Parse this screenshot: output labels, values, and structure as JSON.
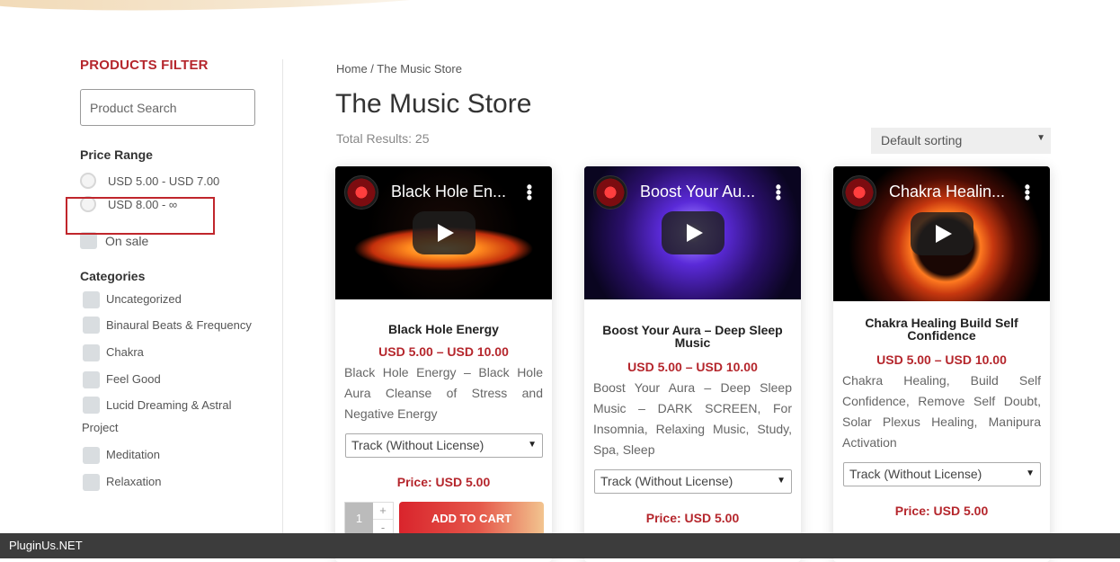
{
  "sidebar": {
    "filter_title": "PRODUCTS FILTER",
    "search_placeholder": "Product Search",
    "price_range_title": "Price Range",
    "price_options": [
      "USD 5.00 - USD 7.00",
      "USD 8.00 - ∞"
    ],
    "on_sale_label": "On sale",
    "categories_title": "Categories",
    "categories": [
      "Uncategorized",
      "Binaural Beats & Frequency",
      "Chakra",
      "Feel Good",
      "Lucid Dreaming & Astral Project",
      "Meditation",
      "Relaxation"
    ]
  },
  "main": {
    "breadcrumb": "Home / The Music Store",
    "title": "The Music Store",
    "total_results": "Total Results: 25",
    "sort_selected": "Default sorting"
  },
  "products": [
    {
      "video_title": "Black Hole En...",
      "name": "Black Hole Energy",
      "price_range": "USD 5.00 – USD 10.00",
      "description": "Black Hole Energy – Black Hole Aura Cleanse of Stress and Negative Energy",
      "variation": "Track (Without License)",
      "price": "Price: USD 5.00",
      "qty": "1",
      "qty_plus": "+",
      "qty_minus": "-",
      "cart_label": "ADD TO CART"
    },
    {
      "video_title": "Boost Your Au...",
      "name": "Boost Your Aura – Deep Sleep Music",
      "price_range": "USD 5.00 – USD 10.00",
      "description": "Boost Your Aura – Deep Sleep Music – DARK SCREEN, For Insomnia, Relaxing Music, Study, Spa, Sleep",
      "variation": "Track (Without License)",
      "price": "Price: USD 5.00"
    },
    {
      "video_title": "Chakra Healin...",
      "name": "Chakra Healing Build Self Confidence",
      "price_range": "USD 5.00 – USD 10.00",
      "description": "Chakra Healing, Build Self Confidence, Remove Self Doubt, Solar Plexus Healing, Manipura Activation",
      "variation": "Track (Without License)",
      "price": "Price: USD 5.00"
    }
  ],
  "footer": {
    "brand": "PluginUs.NET"
  },
  "icons": {
    "dropdown": "caret-down-icon",
    "play": "play-icon",
    "more": "kebab-menu-icon",
    "channel": "channel-logo-icon"
  },
  "colors": {
    "accent_red": "#b5262c",
    "button_gradient_start": "#d9242c",
    "button_gradient_end": "#f2c48f",
    "footer_bg": "#3c3c3c"
  }
}
